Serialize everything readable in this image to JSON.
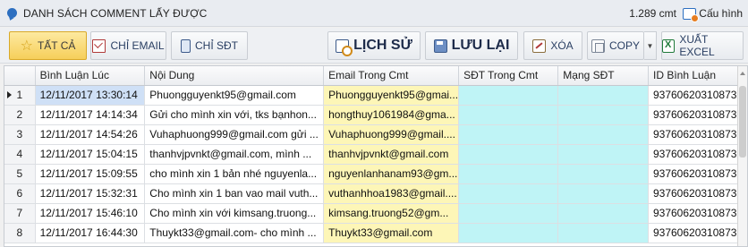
{
  "titlebar": {
    "title": "DANH SÁCH COMMENT LẤY ĐƯỢC",
    "count": "1.289 cmt",
    "config_label": "Cấu hình"
  },
  "toolbar": {
    "all_label": "TẤT CẢ",
    "email_only_label": "CHỈ EMAIL",
    "phone_only_label": "CHỈ SĐT",
    "history_label": "LỊCH SỬ",
    "save_label": "LƯU LẠI",
    "delete_label": "XÓA",
    "copy_label": "COPY",
    "export_label": "XUẤT EXCEL"
  },
  "grid": {
    "columns": [
      "",
      "Bình Luận Lúc",
      "Nội Dung",
      "Email Trong Cmt",
      "SĐT Trong Cmt",
      "Mạng SĐT",
      "ID Bình Luận"
    ],
    "rows": [
      {
        "no": "1",
        "time": "12/11/2017 13:30:14",
        "content": "Phuongguyenkt95@gmail.com",
        "email": "Phuongguyenkt95@gmai...",
        "phone": "",
        "network": "",
        "id": "93760620310873..."
      },
      {
        "no": "2",
        "time": "12/11/2017 14:14:34",
        "content": "Gửi cho mình xin với, tks bạnhon...",
        "email": "hongthuy1061984@gma...",
        "phone": "",
        "network": "",
        "id": "93760620310873..."
      },
      {
        "no": "3",
        "time": "12/11/2017 14:54:26",
        "content": "Vuhaphuong999@gmail.com gửi ...",
        "email": "Vuhaphuong999@gmail....",
        "phone": "",
        "network": "",
        "id": "93760620310873..."
      },
      {
        "no": "4",
        "time": "12/11/2017 15:04:15",
        "content": "thanhvjpvnkt@gmail.com, mình ...",
        "email": "thanhvjpvnkt@gmail.com",
        "phone": "",
        "network": "",
        "id": "93760620310873..."
      },
      {
        "no": "5",
        "time": "12/11/2017 15:09:55",
        "content": "cho mình xin 1 bản nhé nguyenla...",
        "email": "nguyenlanhanam93@gm...",
        "phone": "",
        "network": "",
        "id": "93760620310873..."
      },
      {
        "no": "6",
        "time": "12/11/2017 15:32:31",
        "content": "Cho mình xin 1 ban vao mail vuth...",
        "email": "vuthanhhoa1983@gmail....",
        "phone": "",
        "network": "",
        "id": "93760620310873..."
      },
      {
        "no": "7",
        "time": "12/11/2017 15:46:10",
        "content": "Cho mình xin với kimsang.truong...",
        "email": "kimsang.truong52@gm...",
        "phone": "",
        "network": "",
        "id": "93760620310873..."
      },
      {
        "no": "8",
        "time": "12/11/2017 16:44:30",
        "content": "Thuykt33@gmail.com- cho mình ...",
        "email": "Thuykt33@gmail.com",
        "phone": "",
        "network": "",
        "id": "93760620310873..."
      }
    ]
  },
  "colors": {
    "email_col_bg": "#fdf6b7",
    "phone_col_bg": "#bff4f6",
    "active_button": "#f6cf5a",
    "selected_cell": "#cfe0f6"
  },
  "icons": [
    "comment-icon",
    "config-icon",
    "star-icon",
    "mail-icon",
    "phone-icon",
    "history-icon",
    "save-icon",
    "delete-icon",
    "copy-icon",
    "excel-icon"
  ]
}
